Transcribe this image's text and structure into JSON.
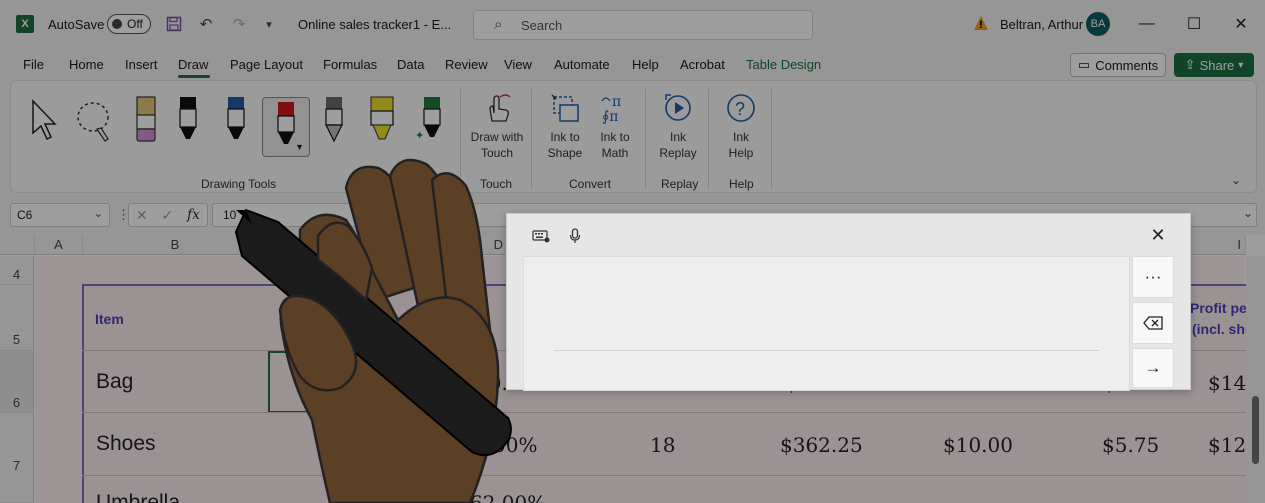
{
  "titlebar": {
    "app_logo": "X",
    "autosave_label": "AutoSave",
    "autosave_state": "Off",
    "doc_title": "Online sales tracker1  -  E...",
    "search_placeholder": "Search",
    "user_name": "Beltran, Arthur",
    "user_initials": "BA"
  },
  "menu": {
    "items": [
      "File",
      "Home",
      "Insert",
      "Draw",
      "Page Layout",
      "Formulas",
      "Data",
      "Review",
      "View",
      "Automate",
      "Help",
      "Acrobat",
      "Table Design"
    ],
    "active": "Draw",
    "comments_label": "Comments",
    "share_label": "Share"
  },
  "ribbon": {
    "groups": {
      "drawing_tools": "Drawing Tools",
      "touch": "Touch",
      "convert": "Convert",
      "replay": "Replay",
      "help": "Help"
    },
    "buttons": {
      "draw_with_touch": [
        "Draw with",
        "Touch"
      ],
      "ink_to_shape": [
        "Ink to",
        "Shape"
      ],
      "ink_to_math": [
        "Ink to",
        "Math"
      ],
      "ink_replay": [
        "Ink",
        "Replay"
      ],
      "ink_help": [
        "Ink",
        "Help"
      ]
    }
  },
  "formula_bar": {
    "name_box": "C6",
    "value": "10"
  },
  "grid": {
    "columns": [
      "A",
      "B",
      "D",
      "I"
    ],
    "rows": [
      "4",
      "5",
      "6",
      "7"
    ],
    "headers": {
      "item": "Item",
      "cost_partial": "st",
      "profit_line1": "Profit pe",
      "profit_line2": "(incl. shi"
    },
    "data_rows": [
      {
        "item": "Bag",
        "markup": "00.",
        "qty": "9",
        "col_g": "$",
        "col_h": "$",
        "profit": "$14."
      },
      {
        "item": "Shoes",
        "cost": "$",
        "markup": "00%",
        "qty": "18",
        "revenue": "$362.25",
        "shipping": "$10.00",
        "fees": "$5.75",
        "profit": "$12."
      }
    ],
    "partial_row": {
      "item": "Umbrella",
      "markup": "62.00%"
    }
  },
  "handwriting_panel": {
    "keyboard_icon": "keyboard-settings-icon",
    "mic_icon": "microphone-icon",
    "more_label": "···",
    "backspace_icon": "backspace-icon",
    "enter_icon": "arrow-right-icon"
  }
}
